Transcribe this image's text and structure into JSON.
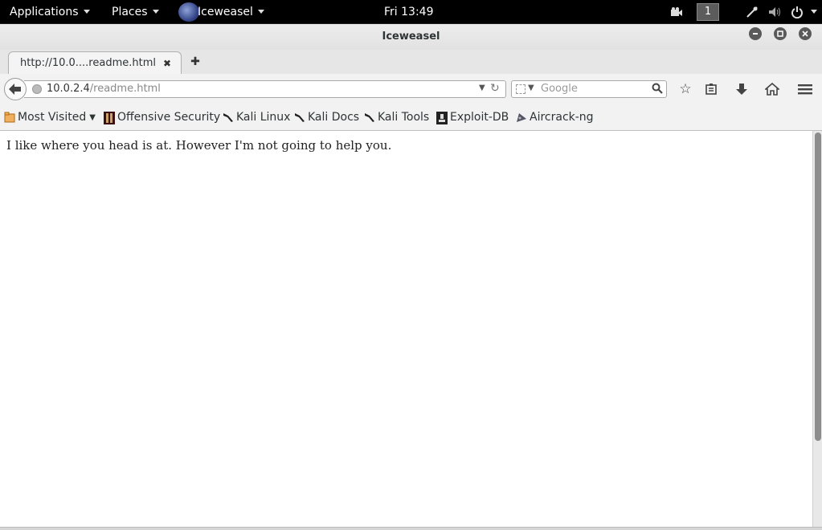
{
  "topbar": {
    "applications": "Applications",
    "places": "Places",
    "app_name": "Iceweasel",
    "clock": "Fri 13:49",
    "workspace": "1"
  },
  "window": {
    "title": "Iceweasel"
  },
  "tabs": [
    {
      "title": "http://10.0....readme.html"
    }
  ],
  "navbar": {
    "url_host": "10.0.2.4",
    "url_path": "/readme.html",
    "search_placeholder": "Google"
  },
  "bookmarks": {
    "most_visited": "Most Visited",
    "items": [
      {
        "label": "Offensive Security",
        "icon": "offsec-icon"
      },
      {
        "label": "Kali Linux",
        "icon": "kali-dragon-icon"
      },
      {
        "label": "Kali Docs",
        "icon": "kali-dragon-icon"
      },
      {
        "label": "Kali Tools",
        "icon": "kali-dragon-icon"
      },
      {
        "label": "Exploit-DB",
        "icon": "exploitdb-icon"
      },
      {
        "label": "Aircrack-ng",
        "icon": "aircrack-icon"
      }
    ]
  },
  "content": {
    "text": "I like where you head is at. However I'm not going to help you."
  }
}
